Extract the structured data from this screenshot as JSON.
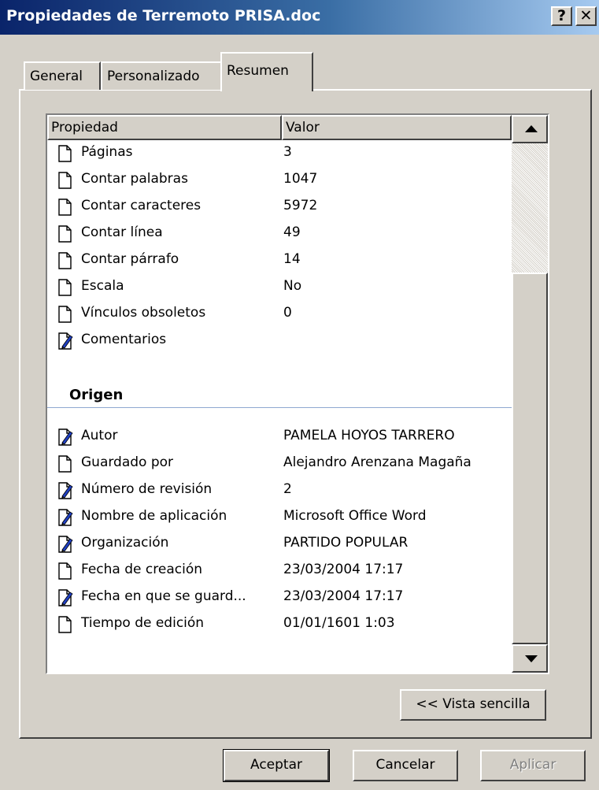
{
  "window": {
    "title": "Propiedades de Terremoto PRISA.doc",
    "help_glyph": "?",
    "close_glyph": "✕"
  },
  "tabs": [
    {
      "label": "General"
    },
    {
      "label": "Personalizado"
    },
    {
      "label": "Resumen"
    }
  ],
  "list": {
    "header_property": "Propiedad",
    "header_value": "Valor",
    "group_origin": "Origen",
    "rows_stats": [
      {
        "name": "Páginas",
        "value": "3",
        "icon": "document-icon"
      },
      {
        "name": "Contar palabras",
        "value": "1047",
        "icon": "document-icon"
      },
      {
        "name": "Contar caracteres",
        "value": "5972",
        "icon": "document-icon"
      },
      {
        "name": "Contar línea",
        "value": "49",
        "icon": "document-icon"
      },
      {
        "name": "Contar párrafo",
        "value": "14",
        "icon": "document-icon"
      },
      {
        "name": "Escala",
        "value": "No",
        "icon": "document-icon"
      },
      {
        "name": "Vínculos obsoletos",
        "value": "0",
        "icon": "document-icon"
      },
      {
        "name": "Comentarios",
        "value": "",
        "icon": "edit-document-icon"
      }
    ],
    "rows_origin": [
      {
        "name": "Autor",
        "value": "PAMELA HOYOS TARRERO",
        "icon": "edit-document-icon"
      },
      {
        "name": "Guardado por",
        "value": "Alejandro Arenzana Magaña",
        "icon": "document-icon"
      },
      {
        "name": "Número de revisión",
        "value": "2",
        "icon": "edit-document-icon"
      },
      {
        "name": "Nombre de aplicación",
        "value": "Microsoft Office Word",
        "icon": "edit-document-icon"
      },
      {
        "name": "Organización",
        "value": "PARTIDO POPULAR",
        "icon": "edit-document-icon"
      },
      {
        "name": "Fecha de creación",
        "value": "23/03/2004 17:17",
        "icon": "document-icon"
      },
      {
        "name": "Fecha en que se guard...",
        "value": "23/03/2004 17:17",
        "icon": "edit-document-icon"
      },
      {
        "name": "Tiempo de edición",
        "value": "01/01/1601 1:03",
        "icon": "document-icon"
      }
    ]
  },
  "buttons": {
    "simple_view": "<< Vista sencilla",
    "ok": "Aceptar",
    "cancel": "Cancelar",
    "apply": "Aplicar"
  }
}
